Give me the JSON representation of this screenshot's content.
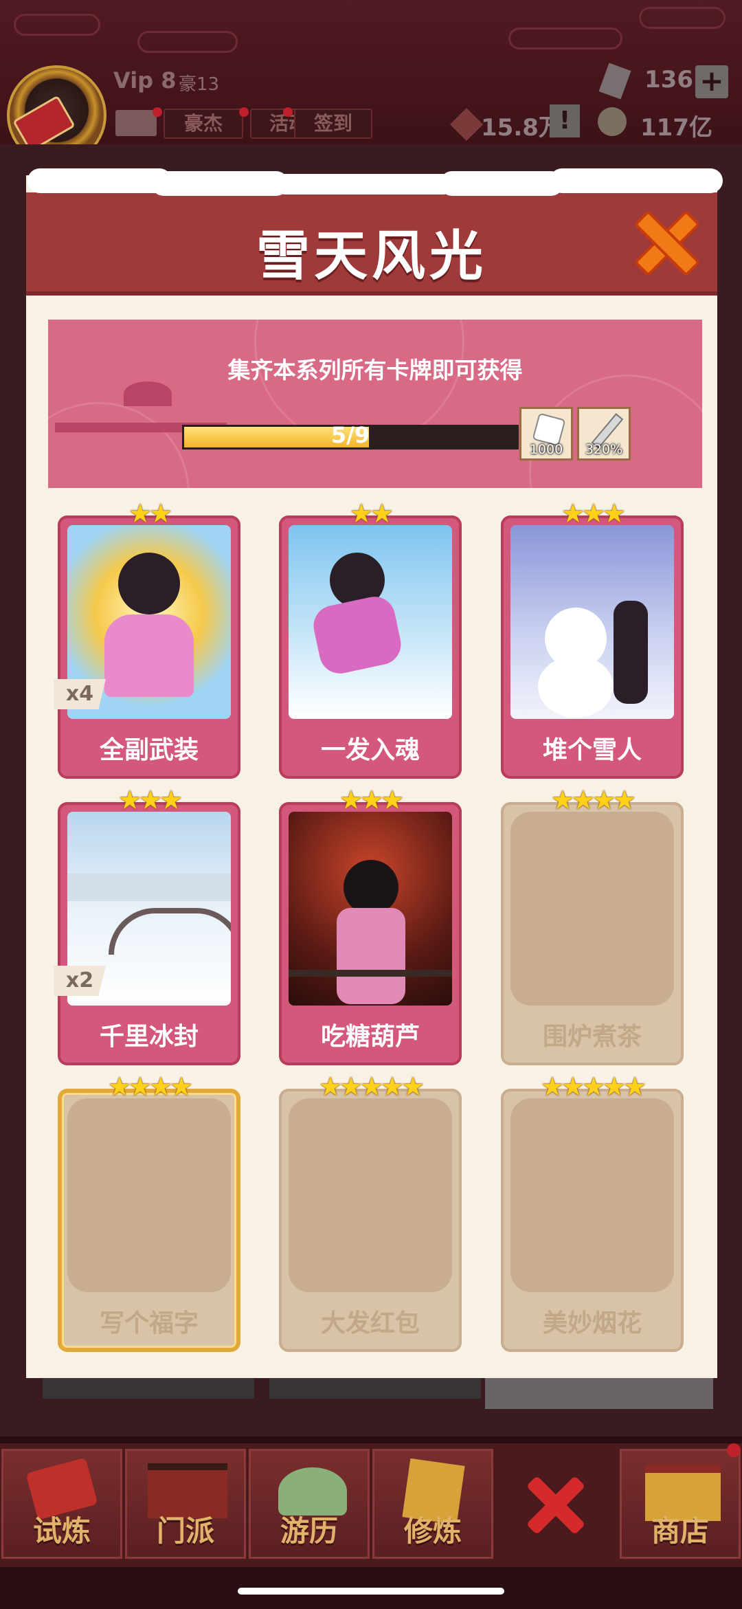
{
  "status": {
    "vip_label": "Vip 8",
    "rank_label": "豪13",
    "gems": "136",
    "plus": "+",
    "silver": "15.8万",
    "alert": "!",
    "gold": "117亿"
  },
  "top_buttons": {
    "hero": "豪杰",
    "activity": "活动",
    "signin": "签到"
  },
  "modal": {
    "title": "雪天风光",
    "banner_text": "集齐本系列所有卡牌即可获得",
    "progress_text": "5/9",
    "progress_fraction": 0.556,
    "rewards": [
      {
        "icon": "dice-icon",
        "value": "1000"
      },
      {
        "icon": "sword-icon",
        "value": "320%"
      }
    ]
  },
  "cards": [
    {
      "name": "全副武装",
      "stars": "★★",
      "count": "x4",
      "owned": true
    },
    {
      "name": "一发入魂",
      "stars": "★★",
      "count": "",
      "owned": true
    },
    {
      "name": "堆个雪人",
      "stars": "★★★",
      "count": "",
      "owned": true
    },
    {
      "name": "千里冰封",
      "stars": "★★★",
      "count": "x2",
      "owned": true
    },
    {
      "name": "吃糖葫芦",
      "stars": "★★★",
      "count": "",
      "owned": true
    },
    {
      "name": "围炉煮茶",
      "stars": "★★★★",
      "count": "",
      "owned": false
    },
    {
      "name": "写个福字",
      "stars": "★★★★",
      "count": "",
      "owned": false
    },
    {
      "name": "大发红包",
      "stars": "★★★★★",
      "count": "",
      "owned": false
    },
    {
      "name": "美妙烟花",
      "stars": "★★★★★",
      "count": "",
      "owned": false
    }
  ],
  "bottom_nav": {
    "trial": "试炼",
    "sect": "门派",
    "travel": "游历",
    "cultivate": "修炼",
    "shop": "商店"
  }
}
